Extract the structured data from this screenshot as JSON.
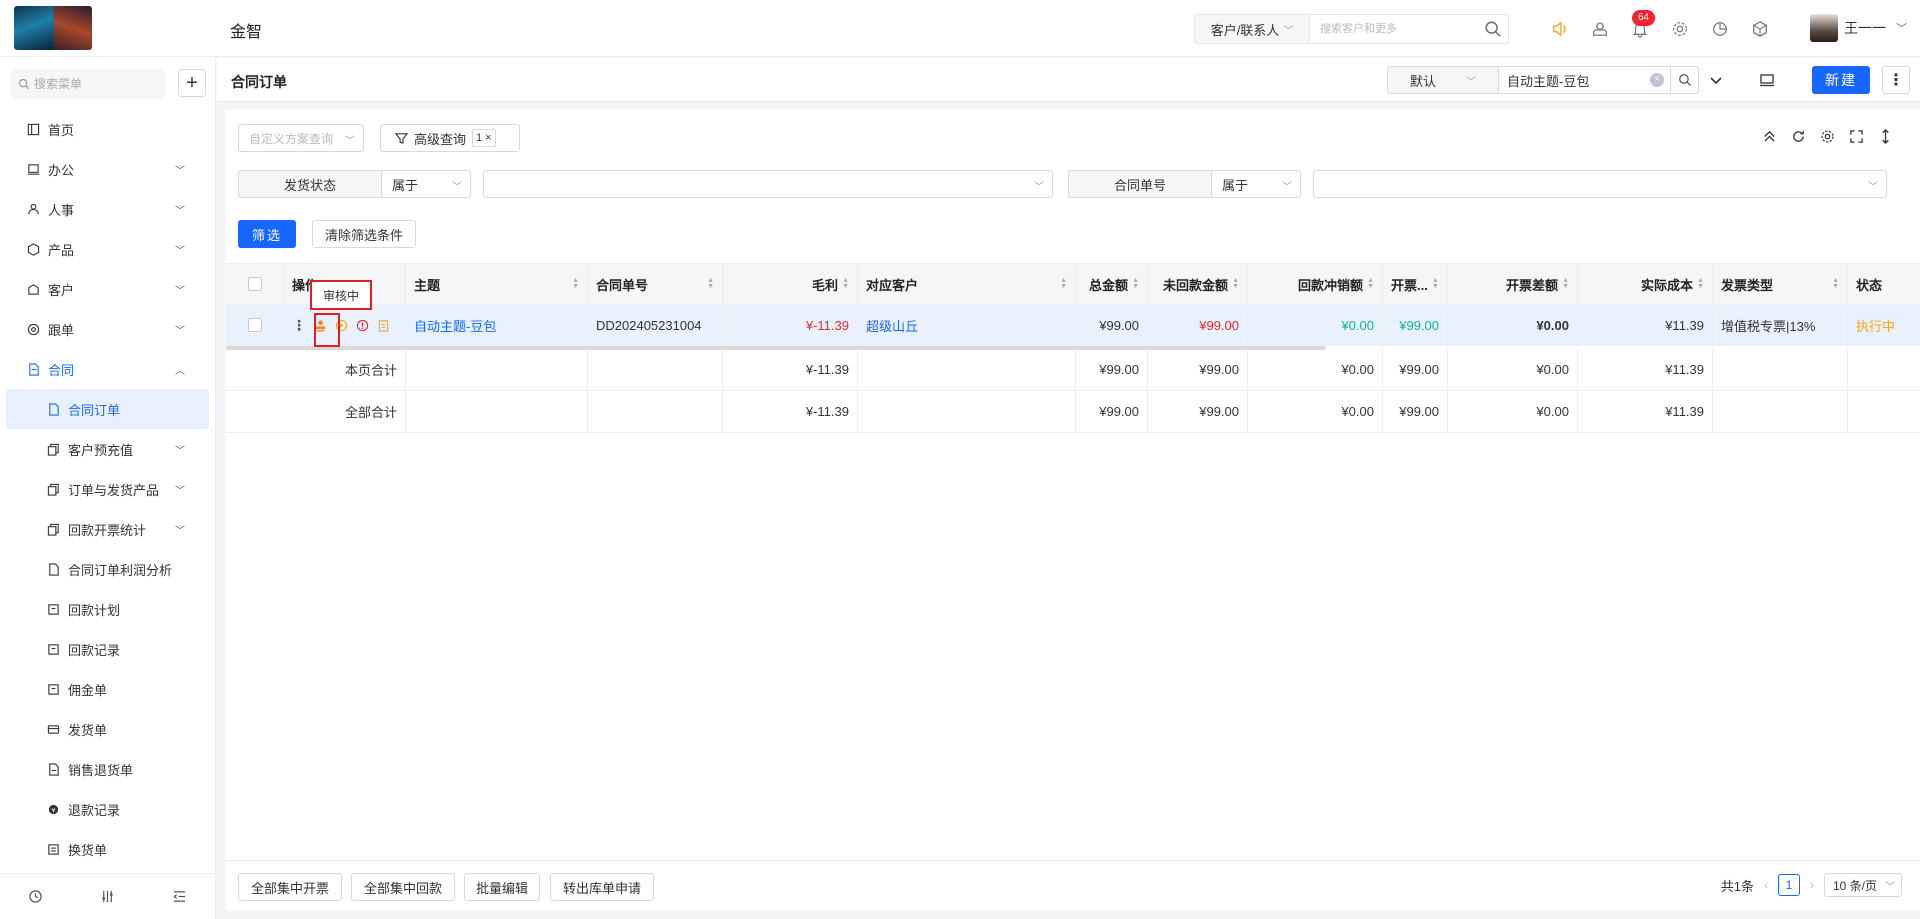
{
  "brand": "金智",
  "top": {
    "search_type": "客户/联系人",
    "search_placeholder": "搜索客户和更多",
    "notification_count": "64",
    "user_name": "王一一"
  },
  "sidebar": {
    "search_placeholder": "搜索菜单",
    "items": [
      {
        "label": "首页",
        "icon": "home-icon"
      },
      {
        "label": "办公",
        "icon": "office-icon"
      },
      {
        "label": "人事",
        "icon": "hr-icon"
      },
      {
        "label": "产品",
        "icon": "product-icon"
      },
      {
        "label": "客户",
        "icon": "customer-icon"
      },
      {
        "label": "跟单",
        "icon": "follow-icon"
      },
      {
        "label": "合同",
        "icon": "contract-icon"
      }
    ],
    "sub_items": [
      {
        "label": "合同订单"
      },
      {
        "label": "客户预充值"
      },
      {
        "label": "订单与发货产品"
      },
      {
        "label": "回款开票统计"
      },
      {
        "label": "合同订单利润分析"
      },
      {
        "label": "回款计划"
      },
      {
        "label": "回款记录"
      },
      {
        "label": "佣金单"
      },
      {
        "label": "发货单"
      },
      {
        "label": "销售退货单"
      },
      {
        "label": "退款记录"
      },
      {
        "label": "换货单"
      }
    ]
  },
  "page": {
    "title": "合同订单",
    "view": "默认",
    "keyword": "自动主题-豆包",
    "new_label": "新建"
  },
  "filters": {
    "scheme_placeholder": "自定义方案查询",
    "adv_query": "高级查询",
    "adv_count": "1",
    "field1": "发货状态",
    "op1": "属于",
    "field2": "合同单号",
    "op2": "属于",
    "filter_btn": "筛选",
    "clear_btn": "清除筛选条件"
  },
  "table": {
    "headers": {
      "op": "操作",
      "subject": "主题",
      "contract_no": "合同单号",
      "gross_profit": "毛利",
      "customer": "对应客户",
      "total": "总金额",
      "unpaid": "未回款金额",
      "write_off": "回款冲销额",
      "invoiced": "开票...",
      "invoice_diff": "开票差额",
      "actual_cost": "实际成本",
      "invoice_type": "发票类型",
      "status": "状态"
    },
    "row": {
      "subject": "自动主题-豆包",
      "contract_no": "DD202405231004",
      "gross_profit": "¥-11.39",
      "customer": "超级山丘",
      "total": "¥99.00",
      "unpaid": "¥99.00",
      "write_off": "¥0.00",
      "invoiced": "¥99.00",
      "invoice_diff": "¥0.00",
      "actual_cost": "¥11.39",
      "invoice_type": "增值税专票|13%",
      "status": "执行中"
    },
    "page_sum": {
      "label": "本页合计",
      "gross_profit": "¥-11.39",
      "total": "¥99.00",
      "unpaid": "¥99.00",
      "write_off": "¥0.00",
      "invoiced": "¥99.00",
      "invoice_diff": "¥0.00",
      "actual_cost": "¥11.39"
    },
    "all_sum": {
      "label": "全部合计",
      "gross_profit": "¥-11.39",
      "total": "¥99.00",
      "unpaid": "¥99.00",
      "write_off": "¥0.00",
      "invoiced": "¥99.00",
      "invoice_diff": "¥0.00",
      "actual_cost": "¥11.39"
    },
    "tooltip": "审核中"
  },
  "footer": {
    "btn1": "全部集中开票",
    "btn2": "全部集中回款",
    "btn3": "批量编辑",
    "btn4": "转出库单申请",
    "total_text": "共1条",
    "page": "1",
    "page_size": "10 条/页"
  },
  "colors": {
    "primary": "#1766ff",
    "danger": "#f5222d",
    "success": "#13b48c",
    "warning": "#f5a623"
  }
}
